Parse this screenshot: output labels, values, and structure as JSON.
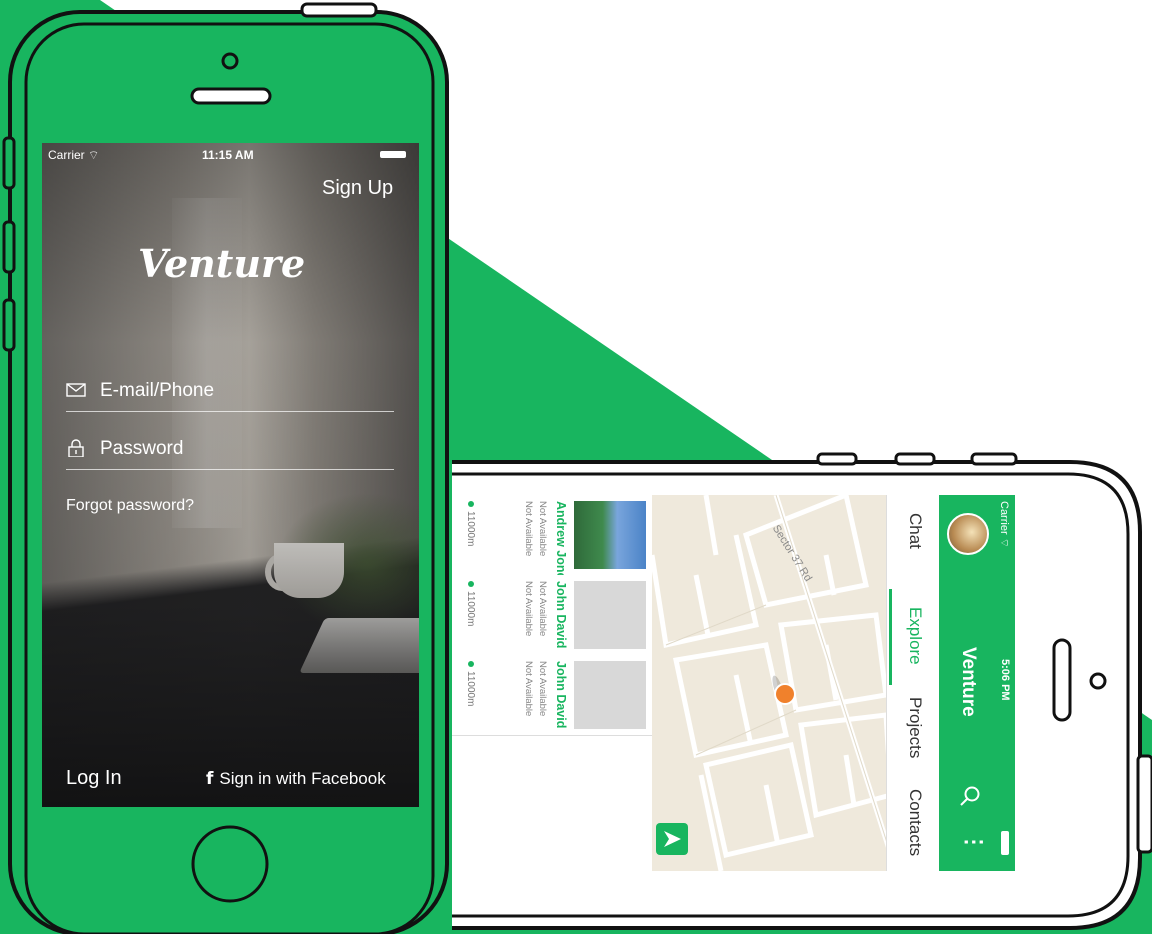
{
  "colors": {
    "accent": "#18B55F",
    "white": "#FFFFFF",
    "outline": "#111111"
  },
  "login": {
    "status": {
      "carrier": "Carrier",
      "time": "11:15 AM"
    },
    "sign_up": "Sign Up",
    "logo": "Venture",
    "email_placeholder": "E-mail/Phone",
    "password_placeholder": "Password",
    "forgot": "Forgot password?",
    "log_in": "Log In",
    "facebook": "Sign in with Facebook",
    "icons": {
      "email": "envelope-icon",
      "password": "lock-icon",
      "facebook": "facebook-icon",
      "wifi": "wifi-icon",
      "battery": "battery-icon"
    }
  },
  "explore": {
    "status": {
      "carrier": "Carrier",
      "time": "5:06 PM"
    },
    "title": "Venture",
    "tabs": [
      "Chat",
      "Explore",
      "Projects",
      "Contacts"
    ],
    "active_tab": "Explore",
    "map_road": "Sector 37 Rd",
    "people": [
      {
        "name": "Andrew Jones",
        "status1": "Not Available",
        "status2": "Not Available",
        "distance": "11000m"
      },
      {
        "name": "John David",
        "status1": "Not Available",
        "status2": "Not Available",
        "distance": "11000m"
      },
      {
        "name": "John David",
        "status1": "Not Available",
        "status2": "Not Available",
        "distance": "11000m"
      }
    ],
    "icons": {
      "search": "search-icon",
      "menu": "more-dots-icon",
      "pin": "map-pin-icon",
      "locate": "navigation-arrow-icon",
      "avatar": "avatar"
    }
  }
}
